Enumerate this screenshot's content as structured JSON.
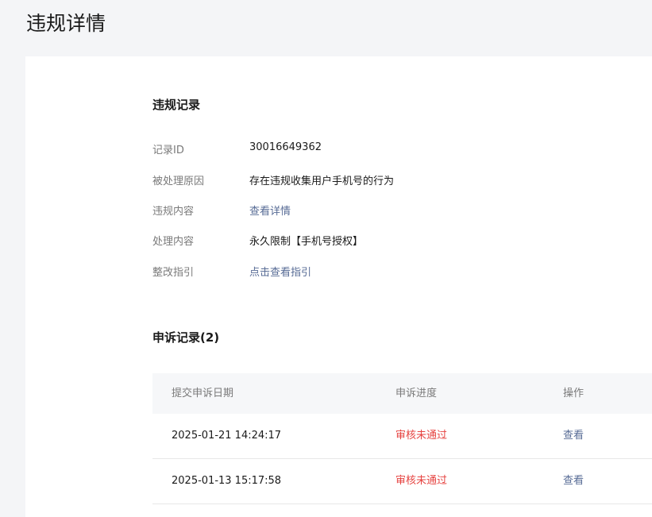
{
  "page": {
    "title": "违规详情"
  },
  "record": {
    "section_title": "违规记录",
    "fields": [
      {
        "label": "记录ID",
        "value": "30016649362"
      },
      {
        "label": "被处理原因",
        "value": "存在违规收集用户手机号的行为"
      },
      {
        "label": "违规内容",
        "value": "查看详情"
      },
      {
        "label": "处理内容",
        "value": "永久限制【手机号授权】"
      },
      {
        "label": "整改指引",
        "value": "点击查看指引"
      }
    ]
  },
  "appeals": {
    "section_title": "申诉记录(2)",
    "columns": [
      "提交申诉日期",
      "申诉进度",
      "操作"
    ],
    "rows": [
      {
        "date": "2025-01-21 14:24:17",
        "status": "审核未通过",
        "action": "查看"
      },
      {
        "date": "2025-01-13 15:17:58",
        "status": "审核未通过",
        "action": "查看"
      }
    ]
  },
  "colors": {
    "link": "#576b95",
    "fail": "#e64340",
    "background": "#f4f5f7"
  }
}
